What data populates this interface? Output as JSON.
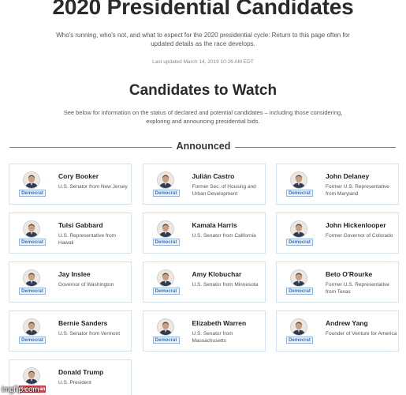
{
  "page": {
    "title": "2020 Presidential Candidates",
    "intro": "Who's running, who's not, and what to expect for the 2020 presidential cycle: Return to this page often for updated details as the race develops.",
    "updated": "Last updated March 14, 2019 10:26 AM EDT"
  },
  "section": {
    "title": "Candidates to Watch",
    "description": "See below for information on the status of declared and potential candidates – including those considering, exploring and announcing presidential bids.",
    "announced_label": "Announced"
  },
  "colors": {
    "democrat": "#3a73b5",
    "republican": "#d8424a",
    "card_border": "#d6e3ea"
  },
  "candidates": [
    {
      "name": "Cory Booker",
      "desc": "U.S. Senator from New Jersey",
      "party": "Democrat",
      "party_key": "dem",
      "icon": "candidate-photo"
    },
    {
      "name": "Julián Castro",
      "desc": "Former Sec. of Housing and Urban Development",
      "party": "Democrat",
      "party_key": "dem",
      "icon": "candidate-photo"
    },
    {
      "name": "John Delaney",
      "desc": "Former U.S. Representative from Maryland",
      "party": "Democrat",
      "party_key": "dem",
      "icon": "candidate-photo"
    },
    {
      "name": "Tulsi Gabbard",
      "desc": "U.S. Representative from Hawaii",
      "party": "Democrat",
      "party_key": "dem",
      "icon": "candidate-photo"
    },
    {
      "name": "Kamala Harris",
      "desc": "U.S. Senator from California",
      "party": "Democrat",
      "party_key": "dem",
      "icon": "candidate-photo"
    },
    {
      "name": "John Hickenlooper",
      "desc": "Former Governor of Colorado",
      "party": "Democrat",
      "party_key": "dem",
      "icon": "candidate-photo"
    },
    {
      "name": "Jay Inslee",
      "desc": "Governor of Washington",
      "party": "Democrat",
      "party_key": "dem",
      "icon": "candidate-photo"
    },
    {
      "name": "Amy Klobuchar",
      "desc": "U.S. Senator from Minnesota",
      "party": "Democrat",
      "party_key": "dem",
      "icon": "candidate-photo"
    },
    {
      "name": "Beto O'Rourke",
      "desc": "Former U.S. Representative from Texas",
      "party": "Democrat",
      "party_key": "dem",
      "icon": "candidate-photo"
    },
    {
      "name": "Bernie Sanders",
      "desc": "U.S. Senator from Vermont",
      "party": "Democrat",
      "party_key": "dem",
      "icon": "candidate-photo"
    },
    {
      "name": "Elizabeth Warren",
      "desc": "U.S. Senator from Massachusetts",
      "party": "Democrat",
      "party_key": "dem",
      "icon": "candidate-photo"
    },
    {
      "name": "Andrew Yang",
      "desc": "Founder of Venture for America",
      "party": "Democrat",
      "party_key": "dem",
      "icon": "candidate-photo"
    },
    {
      "name": "Donald Trump",
      "desc": "U.S. President",
      "party": "Republican",
      "party_key": "rep",
      "icon": "candidate-photo"
    }
  ],
  "watermark": "imgflip.com"
}
